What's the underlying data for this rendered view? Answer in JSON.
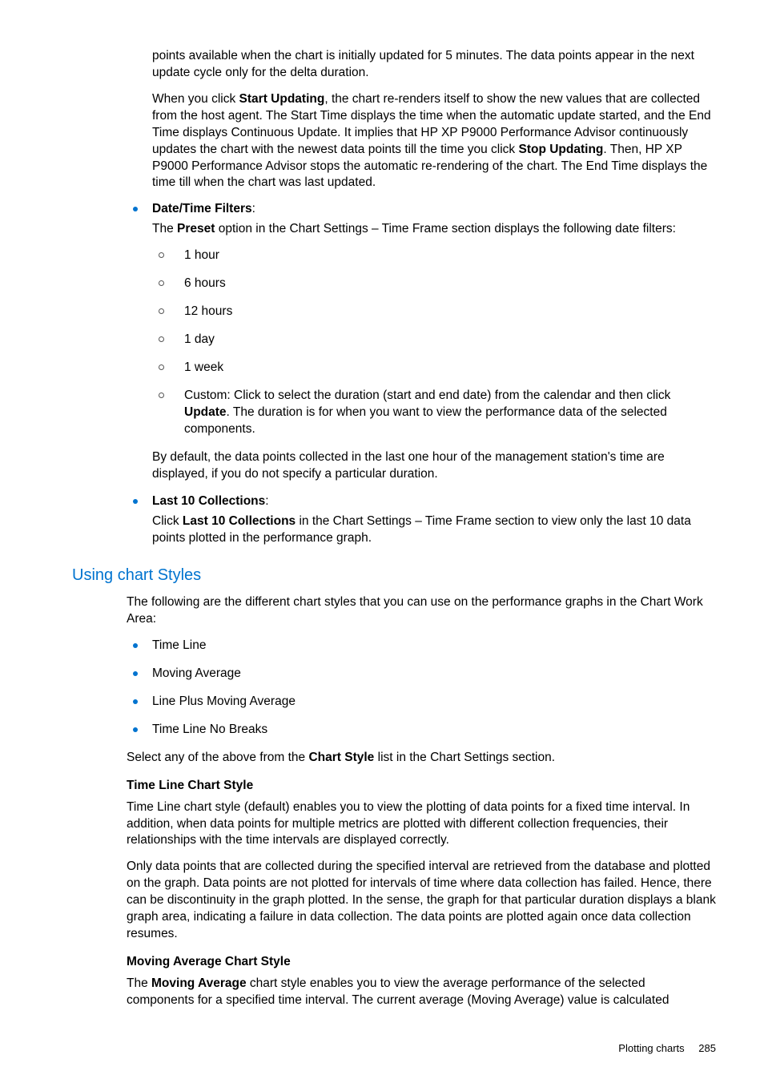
{
  "intro": {
    "para1": "points available when the chart is initially updated for 5 minutes. The data points appear in the next update cycle only for the delta duration.",
    "para2_a": "When you click ",
    "para2_b_bold": "Start Updating",
    "para2_c": ", the chart re-renders itself to show the new values that are collected from the host agent. The Start Time displays the time when the automatic update started, and the End Time displays Continuous Update. It implies that HP XP P9000 Performance Advisor continuously updates the chart with the newest data points till the time you click ",
    "para2_d_bold": "Stop Updating",
    "para2_e": ". Then, HP XP P9000 Performance Advisor stops the automatic re-rendering of the chart. The End Time displays the time till when the chart was last updated."
  },
  "bullets": {
    "date_time": {
      "title": "Date/Time Filters",
      "colon": ":",
      "intro_a": "The ",
      "intro_b_bold": "Preset",
      "intro_c": " option in the Chart Settings – Time Frame section displays the following date filters:",
      "items": {
        "i0": "1 hour",
        "i1": "6 hours",
        "i2": "12 hours",
        "i3": "1 day",
        "i4": "1 week",
        "i5_a": "Custom: Click to select the duration (start and end date) from the calendar and then click ",
        "i5_b_bold": "Update",
        "i5_c": ". The duration is for when you want to view the performance data of the selected components."
      },
      "outro": "By default, the data points collected in the last one hour of the management station's time are displayed, if you do not specify a particular duration."
    },
    "last10": {
      "title": "Last 10 Collections",
      "colon": ":",
      "body_a": "Click ",
      "body_b_bold": "Last 10 Collections",
      "body_c": " in the Chart Settings – Time Frame section to view only the last 10 data points plotted in the performance graph."
    }
  },
  "styles_section": {
    "heading": "Using chart Styles",
    "intro": "The following are the different chart styles that you can use on the performance graphs in the Chart Work Area:",
    "items": {
      "s0": "Time Line",
      "s1": "Moving Average",
      "s2": "Line Plus Moving Average",
      "s3": "Time Line No Breaks"
    },
    "select_a": "Select any of the above from the ",
    "select_b_bold": "Chart Style",
    "select_c": " list in the Chart Settings section.",
    "timeline": {
      "head": "Time Line Chart Style",
      "p1": "Time Line chart style (default) enables you to view the plotting of data points for a fixed time interval. In addition, when data points for multiple metrics are plotted with different collection frequencies, their relationships with the time intervals are displayed correctly.",
      "p2": "Only data points that are collected during the specified interval are retrieved from the database and plotted on the graph. Data points are not plotted for intervals of time where data collection has failed. Hence, there can be discontinuity in the graph plotted. In the sense, the graph for that particular duration displays a blank graph area, indicating a failure in data collection. The data points are plotted again once data collection resumes."
    },
    "moving_avg": {
      "head": "Moving Average Chart Style",
      "p1_a": "The ",
      "p1_b_bold": "Moving Average",
      "p1_c": " chart style enables you to view the average performance of the selected components for a specified time interval. The current average (Moving Average) value is calculated"
    }
  },
  "footer": {
    "label": "Plotting charts",
    "page": "285"
  }
}
